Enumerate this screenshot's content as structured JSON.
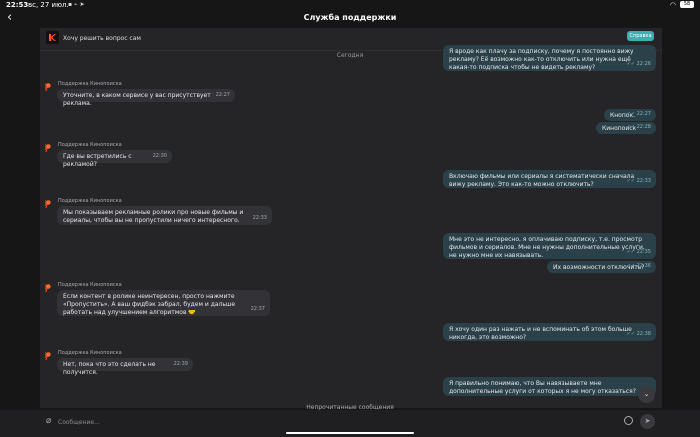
{
  "status": {
    "time": "22:53",
    "date": "вс, 27 июл.",
    "battery": "58"
  },
  "header": {
    "title": "Служба поддержки",
    "back": "‹"
  },
  "pinned": {
    "text": "Хочу решить вопрос сам",
    "help_button": "Справка"
  },
  "day_label": "Сегодня",
  "bot_name": "Поддержка Кинопоиска",
  "messages": [
    {
      "text": "Я вроде как плачу за подписку, почему я постоянно вижу рекламу? Её возможно как-то отключить или нужна ещё какая-то подписка чтобы не видеть рекламу?",
      "time": "22:26"
    },
    {
      "text": "Уточните, в каком сервисе у вас присутствует реклама.",
      "time": "22:27"
    },
    {
      "text": "Кнопок.",
      "time": "22:27"
    },
    {
      "text": "Кинопоиск",
      "time": "22:28"
    },
    {
      "text": "Где вы встретились с рекламой?",
      "time": "22:30"
    },
    {
      "text": "Включаю фильмы или сериалы я систематически сначала вижу рекламу. Это как-то можно отключить?",
      "time": "22:33"
    },
    {
      "text": "Мы показываем рекламные ролики про новые фильмы и сериалы, чтобы вы не пропустили ничего интересного.",
      "time": "22:33"
    },
    {
      "text": "Мне это не интересно, я оплачиваю подписку, т.е. просмотр фильмов и сериалов. Мне не нужны дополнительные услуги, не нужно мне их навязывать.",
      "time": "22:35"
    },
    {
      "text": "Их возможности отключить?",
      "time": "22:36"
    },
    {
      "text": "Если контент в ролике неинтересен, просто нажмите «Пропустить». А ваш фидбэк забрал, будем и дальше работать над улучшением алгоритмов 🤝",
      "time": "22:37"
    },
    {
      "text": "Я хочу один раз нажать и не вспоминать об этом больше никогда, это возможно?",
      "time": "22:38"
    },
    {
      "text": "Нет, пока что это сделать не получится.",
      "time": "22:39"
    },
    {
      "text": "Я правильно понимаю, что Вы навязываете мне дополнительные услуги от которых я не могу отказаться?",
      "time": ""
    }
  ],
  "unread_label": "Непрочитанные сообщения",
  "composer": {
    "placeholder": "Сообщение..."
  },
  "colors": {
    "accent": "#3ab0b0",
    "outgoing": "#2a4149",
    "incoming": "#333337",
    "brand": "#ff5a1f"
  }
}
